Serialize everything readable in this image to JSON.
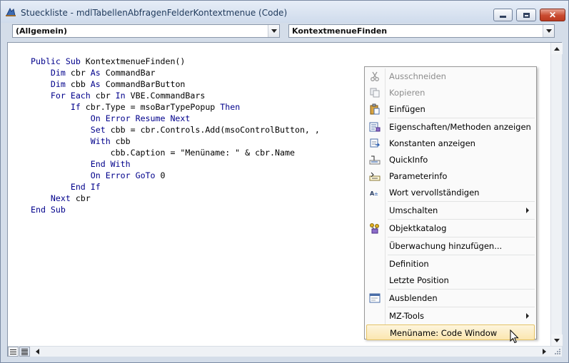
{
  "window": {
    "title": "Stueckliste - mdlTabellenAbfragenFelderKontextmenue (Code)",
    "close_glyph": "✕",
    "icon": "vba-project-icon"
  },
  "object_combo": {
    "value": "(Allgemein)"
  },
  "procedure_combo": {
    "value": "KontextmenueFinden"
  },
  "code": {
    "lines": [
      [
        {
          "t": "Public Sub",
          "k": true
        },
        {
          "t": " KontextmenueFinden()",
          "k": false
        }
      ],
      [
        {
          "t": "    ",
          "k": false
        },
        {
          "t": "Dim",
          "k": true
        },
        {
          "t": " cbr ",
          "k": false
        },
        {
          "t": "As",
          "k": true
        },
        {
          "t": " CommandBar",
          "k": false
        }
      ],
      [
        {
          "t": "    ",
          "k": false
        },
        {
          "t": "Dim",
          "k": true
        },
        {
          "t": " cbb ",
          "k": false
        },
        {
          "t": "As",
          "k": true
        },
        {
          "t": " CommandBarButton",
          "k": false
        }
      ],
      [
        {
          "t": "    ",
          "k": false
        },
        {
          "t": "For Each",
          "k": true
        },
        {
          "t": " cbr ",
          "k": false
        },
        {
          "t": "In",
          "k": true
        },
        {
          "t": " VBE.CommandBars",
          "k": false
        }
      ],
      [
        {
          "t": "        ",
          "k": false
        },
        {
          "t": "If",
          "k": true
        },
        {
          "t": " cbr.Type = msoBarTypePopup ",
          "k": false
        },
        {
          "t": "Then",
          "k": true
        }
      ],
      [
        {
          "t": "            ",
          "k": false
        },
        {
          "t": "On Error Resume Next",
          "k": true
        }
      ],
      [
        {
          "t": "            ",
          "k": false
        },
        {
          "t": "Set",
          "k": true
        },
        {
          "t": " cbb = cbr.Controls.Add(msoControlButton, ,",
          "k": false
        }
      ],
      [
        {
          "t": "            ",
          "k": false
        },
        {
          "t": "With",
          "k": true
        },
        {
          "t": " cbb",
          "k": false
        }
      ],
      [
        {
          "t": "                cbb.Caption = \"Menüname: \" & cbr.Name",
          "k": false
        }
      ],
      [
        {
          "t": "            ",
          "k": false
        },
        {
          "t": "End With",
          "k": true
        }
      ],
      [
        {
          "t": "            ",
          "k": false
        },
        {
          "t": "On Error GoTo",
          "k": true
        },
        {
          "t": " 0",
          "k": false
        }
      ],
      [
        {
          "t": "        ",
          "k": false
        },
        {
          "t": "End If",
          "k": true
        }
      ],
      [
        {
          "t": "    ",
          "k": false
        },
        {
          "t": "Next",
          "k": true
        },
        {
          "t": " cbr",
          "k": false
        }
      ],
      [
        {
          "t": "End Sub",
          "k": true
        }
      ]
    ]
  },
  "context_menu": {
    "items": [
      {
        "label": "Ausschneiden",
        "icon": "scissors-icon",
        "disabled": true
      },
      {
        "label": "Kopieren",
        "icon": "copy-icon",
        "disabled": true
      },
      {
        "label": "Einfügen",
        "icon": "paste-icon"
      },
      {
        "separator": true
      },
      {
        "label": "Eigenschaften/Methoden anzeigen",
        "icon": "properties-methods-icon"
      },
      {
        "label": "Konstanten anzeigen",
        "icon": "constants-icon"
      },
      {
        "label": "QuickInfo",
        "icon": "quickinfo-icon"
      },
      {
        "label": "Parameterinfo",
        "icon": "parameterinfo-icon"
      },
      {
        "label": "Wort vervollständigen",
        "icon": "complete-word-icon"
      },
      {
        "separator": true
      },
      {
        "label": "Umschalten",
        "submenu": true
      },
      {
        "separator": true
      },
      {
        "label": "Objektkatalog",
        "icon": "object-browser-icon"
      },
      {
        "separator": true
      },
      {
        "label": "Überwachung hinzufügen..."
      },
      {
        "separator": true
      },
      {
        "label": "Definition"
      },
      {
        "label": "Letzte Position"
      },
      {
        "separator": true
      },
      {
        "label": "Ausblenden",
        "icon": "window-icon"
      },
      {
        "separator": true
      },
      {
        "label": "MZ-Tools",
        "submenu": true
      },
      {
        "label": "Menüname: Code Window",
        "highlighted": true
      }
    ]
  },
  "colors": {
    "keyword": "#00008b",
    "highlight": "#fbe6b0"
  }
}
